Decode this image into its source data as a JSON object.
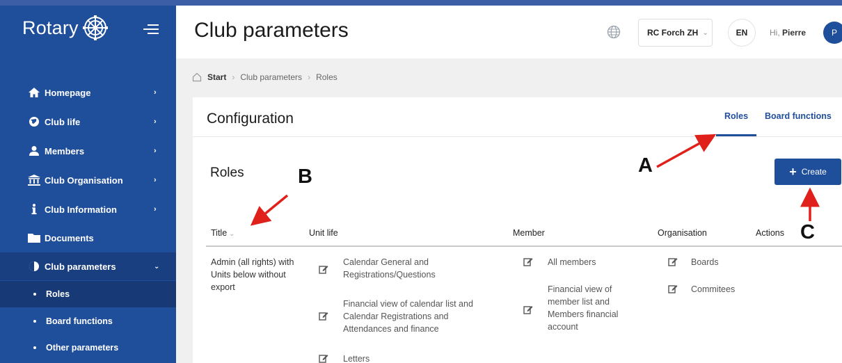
{
  "sidebar": {
    "logo_text": "Rotary",
    "items": [
      {
        "label": "Homepage",
        "icon": "home-icon"
      },
      {
        "label": "Club life",
        "icon": "globe-icon"
      },
      {
        "label": "Members",
        "icon": "user-icon"
      },
      {
        "label": "Club Organisation",
        "icon": "institution-icon"
      },
      {
        "label": "Club Information",
        "icon": "info-icon"
      },
      {
        "label": "Documents",
        "icon": "folder-icon"
      },
      {
        "label": "Club parameters",
        "icon": "toggle-icon"
      }
    ],
    "subitems": [
      {
        "label": "Roles"
      },
      {
        "label": "Board functions"
      },
      {
        "label": "Other parameters"
      }
    ]
  },
  "header": {
    "title": "Club parameters",
    "club": "RC Forch ZH",
    "lang": "EN",
    "greeting_prefix": "Hi,",
    "user_name": "Pierre",
    "avatar_initial": "P"
  },
  "breadcrumb": [
    "Start",
    "Club parameters",
    "Roles"
  ],
  "card": {
    "title": "Configuration",
    "tabs": [
      "Roles",
      "Board functions"
    ]
  },
  "roles": {
    "title": "Roles",
    "create_label": "Create",
    "columns": {
      "title": "Title",
      "unit_life": "Unit life",
      "member": "Member",
      "organisation": "Organisation",
      "actions": "Actions"
    },
    "row": {
      "title": "Admin (all rights) with Units below without export",
      "unit_life": [
        "Calendar General and Registrations/Questions",
        "Financial view of calendar list and Calendar Registrations and Attendances and finance",
        "Letters"
      ],
      "member": [
        "All members",
        "Financial view of member list and Members financial account"
      ],
      "organisation": [
        "Boards",
        "Commitees"
      ]
    }
  },
  "annotations": {
    "a": "A",
    "b": "B",
    "c": "C",
    "color": "#e0211b"
  }
}
